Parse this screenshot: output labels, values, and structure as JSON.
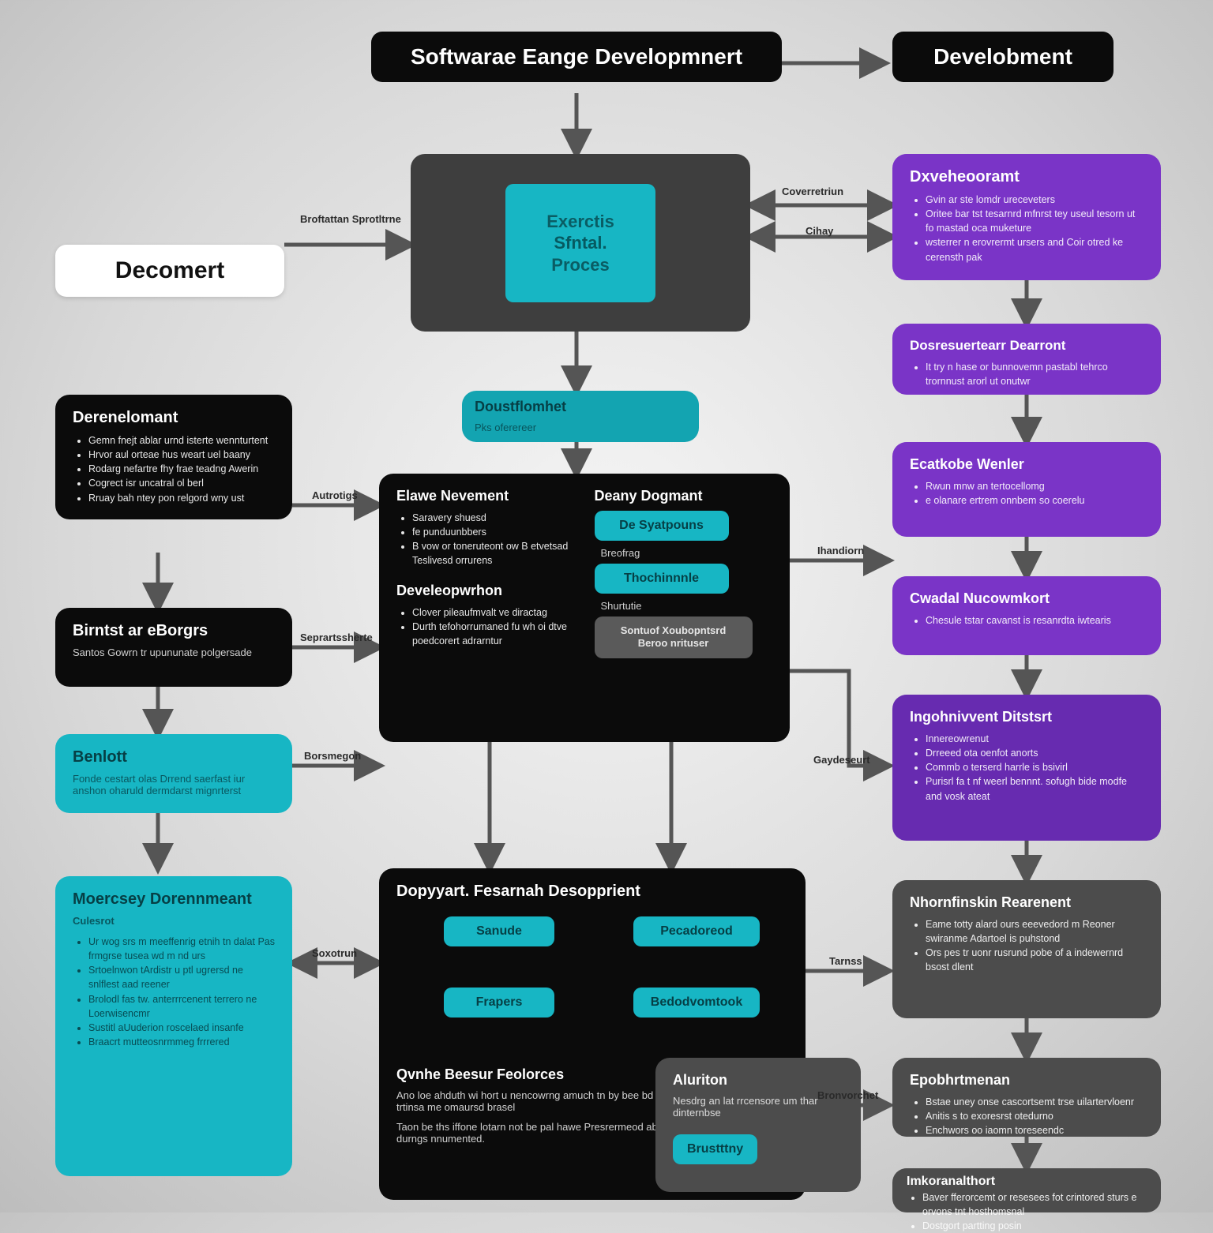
{
  "header": {
    "main_title": "Softwarae Eange Developmnert",
    "right_title": "Develobment"
  },
  "left": {
    "decomert": "Decomert",
    "dev_title": "Derenelomant",
    "dev_items": [
      "Gemn fnejt ablar urnd isterte wennturtent",
      "Hrvor aul orteae hus weart uel baany",
      "Rodarg nefartre fhy frae teadng Awerin",
      "Cogrect isr uncatral ol berl",
      "Rruay bah ntey pon relgord wny ust"
    ],
    "bundles_title": "Birntst ar eBorgrs",
    "bundles_sub": "Santos Gowrn tr upununate polgersade",
    "benlott_title": "Benlott",
    "benlott_sub": "Fonde cestart olas Drrend saerfast iur anshon oharuld dermdarst mignrterst",
    "moercey_title": "Moercsey Dorennmeant",
    "moercey_sub": "Culesrot",
    "moercey_items": [
      "Ur wog srs m meeffenrig etnih tn dalat Pas frmgrse tusea wd m nd urs",
      "Srtoelnwon tArdistr u ptl ugrersd ne snlflest aad reener",
      "Brolodl fas tw. anterrrcenent terrero ne Loerwisencmr",
      "Sustitl aUuderion roscelaed insanfe",
      "Braacrt mutteosnrmmeg frrrered"
    ]
  },
  "center": {
    "hub_big": {
      "line1": "Exerctis",
      "line2": "Sfntal.",
      "line3": "Proces"
    },
    "hub_sub_title": "Doustflomhet",
    "hub_sub_caption": "Pks oferereer",
    "panel1": {
      "col1_title": "Elawe Nevement",
      "col1_items": [
        "Saravery shuesd",
        "fe punduunbbers",
        "B vow or toneruteont ow B etvetsad Teslivesd orrurens"
      ],
      "col1_title2": "Develeopwrhon",
      "col1_items2": [
        "Clover pileaufmvalt ve diractag",
        "Durth tefohorrumaned fu wh oi dtve poedcorert adrarntur"
      ],
      "col2_title": "Deany Dogmant",
      "col2_pill1": "De Syatpouns",
      "col2_lbl1": "Breofrag",
      "col2_pill2": "Thochinnnle",
      "col2_lbl2": "Shurtutie",
      "col2_pill3": "Sontuof Xoubopntsrd Beroo nrituser"
    },
    "panel2": {
      "title": "Dopyyart. Fesarnah Desopprient",
      "pill_tl": "Sanude",
      "pill_tr": "Pecadoreod",
      "pill_bl": "Frapers",
      "pill_br": "Bedodvomtook",
      "qtitle": "Qvnhe Beesur Feolorces",
      "qtext1": "Ano loe ahduth wi hort u nencowrng amuch tn by bee bd reerwonr enors frarso lod frr trtinsa me omaursd brasel",
      "qtext2": "Taon be ths iffone lotarn not be pal hawe Presrermeod aborcsgew wfurs la ov l urne la durngs nnumented.",
      "atitle": "Aluriton",
      "atext": "Nesdrg an lat rrcensore um thar dinternbse",
      "apill": "Brustttny"
    }
  },
  "right": {
    "box1": {
      "title": "Dxveheooramt",
      "items": [
        "Gvin ar ste lomdr ureceveters",
        "Oritee bar tst tesarnrd mfnrst tey useul tesorn ut fo mastad oca muketure",
        "wsterrer n erovrermt ursers and Coir otred ke cerensth pak"
      ]
    },
    "box2": {
      "title": "Dosresuertearr Dearront",
      "items": [
        "It try n hase or bunnovemn pastabl tehrco trornnust arorl ut onutwr"
      ]
    },
    "box3": {
      "title": "Ecatkobe Wenler",
      "items": [
        "Rwun mnw an tertocellomg",
        "e olanare ertrem onnbem so coerelu"
      ]
    },
    "box4": {
      "title": "Cwadal Nucowmkort",
      "items": [
        "Chesule tstar cavanst is resanrdta iwtearis"
      ]
    },
    "box5": {
      "title": "Ingohnivvent Ditstsrt",
      "items": [
        "Innereowrenut",
        "Drreeed ota oenfot anorts",
        "Commb o terserd harrle is bsivirl",
        "Purisrl fa t nf weerl bennnt. sofugh bide modfe and vosk ateat"
      ]
    },
    "box6": {
      "title": "Nhornfinskin Rearenent",
      "items": [
        "Eame totty alard ours eeevedord m Reoner swiranme Adartoel is puhstond",
        "Ors pes tr uonr rusrund pobe of a indewernrd bsost dlent"
      ]
    },
    "box7": {
      "title": "Epobhrtmenan",
      "items": [
        "Bstae uney onse cascortsemt trse uilartervloenr",
        "Anitis s to exoresrst otedurno",
        "Enchwors oo iaomn toreseendc"
      ]
    },
    "box8": {
      "title": "Imkoranalthort",
      "items": [
        "Baver fferorcemt or resesees fot crintored sturs e orvons tnt hosthomsnal",
        "Dostgort partting posin"
      ]
    }
  },
  "labels": {
    "l_left1": "Broftattan Sprotltrne",
    "l_autog": "Autrotigs",
    "l_sepa": "Seprartssherte",
    "l_borsm": "Borsmegon",
    "l_soxo": "Soxotrun",
    "l_cov": "Coverretriun",
    "l_chay": "Cihay",
    "l_ihand": "Ihandiorn",
    "l_gay": "Gaydeseurt",
    "l_tarns": "Tarnss",
    "l_brons": "Bronvorchet"
  }
}
